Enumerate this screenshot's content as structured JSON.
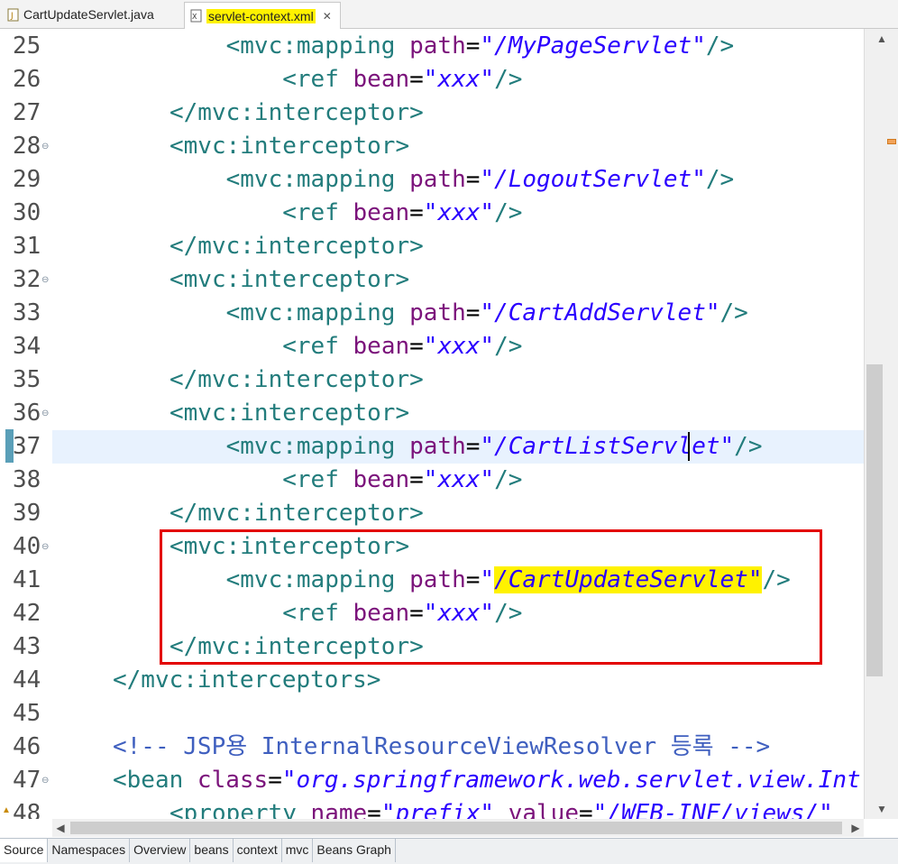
{
  "tabs": [
    {
      "label": "CartUpdateServlet.java",
      "active": false,
      "icon": "java-file-icon"
    },
    {
      "label": "servlet-context.xml",
      "active": true,
      "icon": "xml-file-icon",
      "highlighted": true
    }
  ],
  "editor": {
    "current_line": 37,
    "lines": [
      {
        "num": "25",
        "fold": false,
        "indent": "    ",
        "parts": [
          [
            "tg",
            "<mvc:mapping "
          ],
          [
            "at",
            "path"
          ],
          [
            "eq",
            "="
          ],
          [
            "st",
            "\"/MyPageServlet\""
          ],
          [
            "tg",
            "/>"
          ]
        ]
      },
      {
        "num": "26",
        "fold": false,
        "indent": "        ",
        "parts": [
          [
            "tg",
            "<ref "
          ],
          [
            "at",
            "bean"
          ],
          [
            "eq",
            "="
          ],
          [
            "st",
            "\"xxx\""
          ],
          [
            "tg",
            "/>"
          ]
        ]
      },
      {
        "num": "27",
        "fold": false,
        "indent": "",
        "parts": [
          [
            "tg",
            "</mvc:interceptor>"
          ]
        ]
      },
      {
        "num": "28",
        "fold": true,
        "indent": "",
        "parts": [
          [
            "tg",
            "<mvc:interceptor>"
          ]
        ]
      },
      {
        "num": "29",
        "fold": false,
        "indent": "    ",
        "parts": [
          [
            "tg",
            "<mvc:mapping "
          ],
          [
            "at",
            "path"
          ],
          [
            "eq",
            "="
          ],
          [
            "st",
            "\"/LogoutServlet\""
          ],
          [
            "tg",
            "/>"
          ]
        ]
      },
      {
        "num": "30",
        "fold": false,
        "indent": "        ",
        "parts": [
          [
            "tg",
            "<ref "
          ],
          [
            "at",
            "bean"
          ],
          [
            "eq",
            "="
          ],
          [
            "st",
            "\"xxx\""
          ],
          [
            "tg",
            "/>"
          ]
        ]
      },
      {
        "num": "31",
        "fold": false,
        "indent": "",
        "parts": [
          [
            "tg",
            "</mvc:interceptor>"
          ]
        ]
      },
      {
        "num": "32",
        "fold": true,
        "indent": "",
        "parts": [
          [
            "tg",
            "<mvc:interceptor>"
          ]
        ]
      },
      {
        "num": "33",
        "fold": false,
        "indent": "    ",
        "parts": [
          [
            "tg",
            "<mvc:mapping "
          ],
          [
            "at",
            "path"
          ],
          [
            "eq",
            "="
          ],
          [
            "st",
            "\"/CartAddServlet\""
          ],
          [
            "tg",
            "/>"
          ]
        ]
      },
      {
        "num": "34",
        "fold": false,
        "indent": "        ",
        "parts": [
          [
            "tg",
            "<ref "
          ],
          [
            "at",
            "bean"
          ],
          [
            "eq",
            "="
          ],
          [
            "st",
            "\"xxx\""
          ],
          [
            "tg",
            "/>"
          ]
        ]
      },
      {
        "num": "35",
        "fold": false,
        "indent": "",
        "parts": [
          [
            "tg",
            "</mvc:interceptor>"
          ]
        ]
      },
      {
        "num": "36",
        "fold": true,
        "indent": "",
        "parts": [
          [
            "tg",
            "<mvc:interceptor>"
          ]
        ]
      },
      {
        "num": "37",
        "fold": false,
        "indent": "    ",
        "parts": [
          [
            "tg",
            "<mvc:mapping "
          ],
          [
            "at",
            "path"
          ],
          [
            "eq",
            "="
          ],
          [
            "st",
            "\"/CartListServlet\""
          ],
          [
            "tg",
            "/>"
          ]
        ]
      },
      {
        "num": "38",
        "fold": false,
        "indent": "        ",
        "parts": [
          [
            "tg",
            "<ref "
          ],
          [
            "at",
            "bean"
          ],
          [
            "eq",
            "="
          ],
          [
            "st",
            "\"xxx\""
          ],
          [
            "tg",
            "/>"
          ]
        ]
      },
      {
        "num": "39",
        "fold": false,
        "indent": "",
        "parts": [
          [
            "tg",
            "</mvc:interceptor>"
          ]
        ]
      },
      {
        "num": "40",
        "fold": true,
        "indent": "",
        "parts": [
          [
            "tg",
            "<mvc:interceptor>"
          ]
        ]
      },
      {
        "num": "41",
        "fold": false,
        "indent": "    ",
        "parts": [
          [
            "tg",
            "<mvc:mapping "
          ],
          [
            "at",
            "path"
          ],
          [
            "eq",
            "="
          ],
          [
            "st",
            "\""
          ],
          [
            "sthl",
            "/CartUpdateServlet\""
          ],
          [
            "tg",
            "/>"
          ]
        ]
      },
      {
        "num": "42",
        "fold": false,
        "indent": "        ",
        "parts": [
          [
            "tg",
            "<ref "
          ],
          [
            "at",
            "bean"
          ],
          [
            "eq",
            "="
          ],
          [
            "st",
            "\"xxx\""
          ],
          [
            "tg",
            "/>"
          ]
        ]
      },
      {
        "num": "43",
        "fold": false,
        "indent": "",
        "parts": [
          [
            "tg",
            "</mvc:interceptor>"
          ]
        ]
      },
      {
        "num": "44",
        "fold": false,
        "indent": "",
        "outdent": true,
        "parts": [
          [
            "tg",
            "</mvc:interceptors>"
          ]
        ]
      },
      {
        "num": "45",
        "fold": false,
        "indent": "",
        "outdent": true,
        "parts": []
      },
      {
        "num": "46",
        "fold": false,
        "indent": "",
        "outdent": true,
        "parts": [
          [
            "cm",
            "<!-- JSP용 InternalResourceViewResolver 등록 -->"
          ]
        ]
      },
      {
        "num": "47",
        "fold": true,
        "indent": "",
        "outdent": true,
        "parts": [
          [
            "tg",
            "<bean "
          ],
          [
            "at",
            "class"
          ],
          [
            "eq",
            "="
          ],
          [
            "st",
            "\"org.springframework.web.servlet.view.Int"
          ]
        ]
      },
      {
        "num": "48",
        "fold": false,
        "indent": "",
        "parts": [
          [
            "tg",
            "<property "
          ],
          [
            "at",
            "name"
          ],
          [
            "eq",
            "="
          ],
          [
            "st",
            "\"prefix\""
          ],
          [
            "eq",
            " "
          ],
          [
            "at",
            "value"
          ],
          [
            "eq",
            "="
          ],
          [
            "st",
            "\"/WEB-INF/views/\""
          ]
        ]
      }
    ]
  },
  "bottom_tabs": [
    {
      "label": "Source",
      "active": true
    },
    {
      "label": "Namespaces",
      "active": false
    },
    {
      "label": "Overview",
      "active": false
    },
    {
      "label": "beans",
      "active": false
    },
    {
      "label": "context",
      "active": false
    },
    {
      "label": "mvc",
      "active": false
    },
    {
      "label": "Beans Graph",
      "active": false
    }
  ],
  "colors": {
    "tag": "#227c7c",
    "attribute": "#7b137b",
    "string": "#2a00ff",
    "comment": "#3f5fbf",
    "highlight": "#fff200",
    "annotation_box": "#e30000",
    "current_line_bg": "#e8f2fe"
  }
}
